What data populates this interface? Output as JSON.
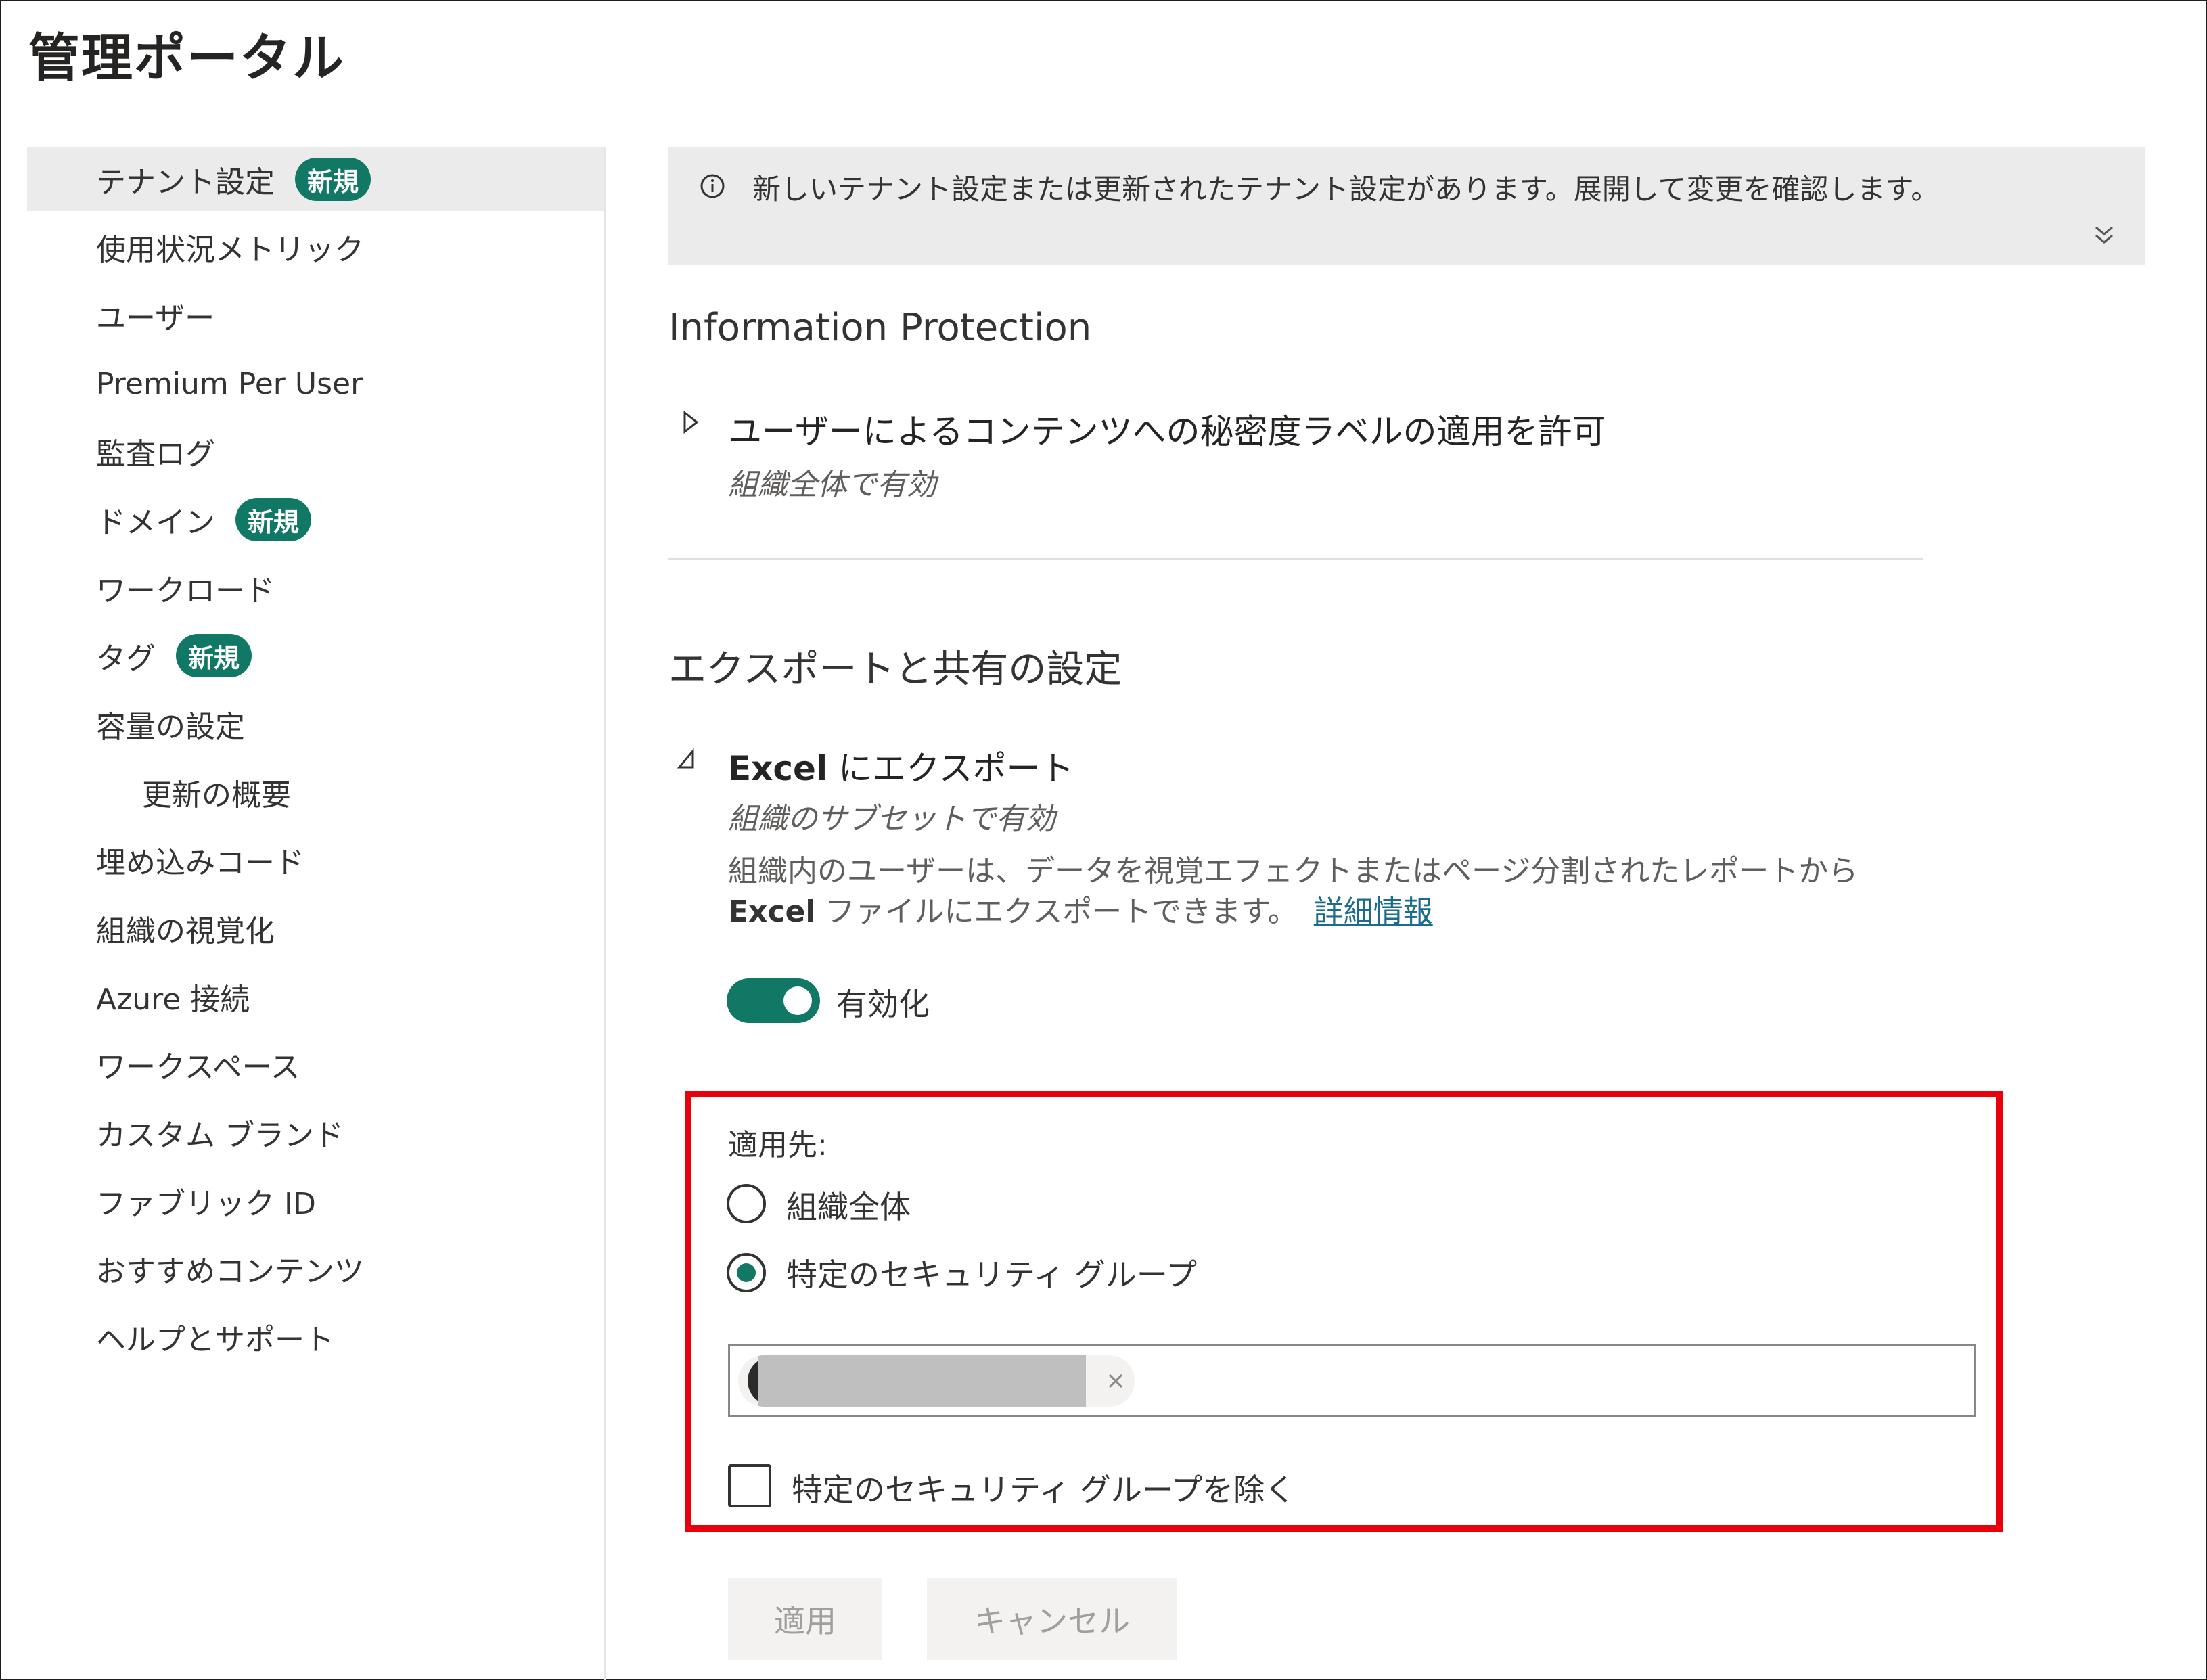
{
  "page": {
    "title": "管理ポータル"
  },
  "sidebar": {
    "items": [
      {
        "label": "テナント設定",
        "badge": "新規",
        "active": true
      },
      {
        "label": "使用状況メトリック"
      },
      {
        "label": "ユーザー"
      },
      {
        "label": "Premium Per User"
      },
      {
        "label": "監査ログ"
      },
      {
        "label": "ドメイン",
        "badge": "新規"
      },
      {
        "label": "ワークロード"
      },
      {
        "label": "タグ",
        "badge": "新規"
      },
      {
        "label": "容量の設定"
      },
      {
        "label": "更新の概要",
        "sub": true
      },
      {
        "label": "埋め込みコード"
      },
      {
        "label": "組織の視覚化"
      },
      {
        "label": "Azure 接続"
      },
      {
        "label": "ワークスペース"
      },
      {
        "label": "カスタム ブランド"
      },
      {
        "label": "ファブリック ID"
      },
      {
        "label": "おすすめコンテンツ"
      },
      {
        "label": "ヘルプとサポート"
      }
    ]
  },
  "banner": {
    "text": "新しいテナント設定または更新されたテナント設定があります。展開して変更を確認します。",
    "info_icon": "info-icon",
    "expand_icon": "double-chevron-down-icon"
  },
  "sections": {
    "info_protection": {
      "title": "Information Protection",
      "setting_title": "ユーザーによるコンテンツへの秘密度ラベルの適用を許可",
      "setting_status": "組織全体で有効",
      "expanded": false
    },
    "export": {
      "title": "エクスポートと共有の設定",
      "setting_title_bold": "Excel",
      "setting_title_rest": " にエクスポート",
      "setting_status": "組織のサブセットで有効",
      "expanded": true,
      "desc_line1": "組織内のユーザーは、データを視覚エフェクトまたはページ分割されたレポートから",
      "desc_line2_bold": "Excel",
      "desc_line2_rest": " ファイルにエクスポートできます。",
      "learn_more": "詳細情報",
      "toggle_label": "有効化",
      "toggle_on": true,
      "apply_to_label": "適用先:",
      "radio_options": [
        {
          "label": "組織全体",
          "selected": false
        },
        {
          "label": "特定のセキュリティ グループ",
          "selected": true
        }
      ],
      "exclude_label": "特定のセキュリティ グループを除く",
      "exclude_checked": false
    }
  },
  "buttons": {
    "apply": "適用",
    "cancel": "キャンセル"
  },
  "colors": {
    "accent": "#117865",
    "highlight": "#e8000b",
    "link": "#1b6b8a"
  }
}
